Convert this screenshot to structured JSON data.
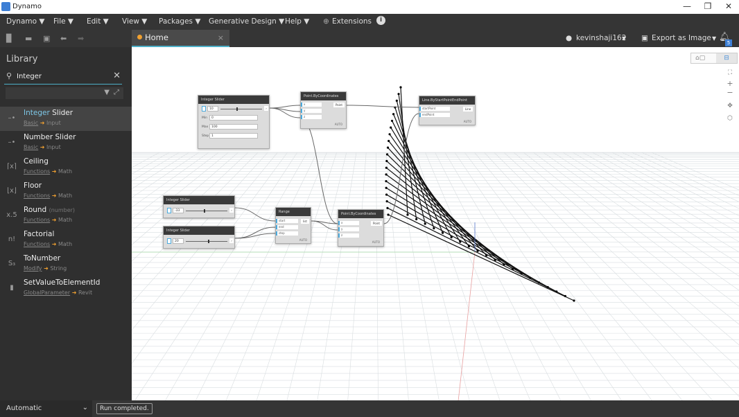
{
  "window": {
    "title": "Dynamo",
    "minimize": "—",
    "restore": "❐",
    "close": "✕"
  },
  "menu": [
    "Dynamo ▼",
    "File ▼",
    "Edit ▼",
    "View ▼",
    "Packages ▼",
    "Generative Design ▼",
    "Help ▼",
    "Extensions"
  ],
  "toolbar": {
    "icons": [
      "new-file-icon",
      "open-folder-icon",
      "save-icon",
      "undo-icon",
      "redo-icon"
    ]
  },
  "tab": {
    "label": "Home",
    "close": "×"
  },
  "topright": {
    "user": "kevinshaji162",
    "user_caret": "▼",
    "export": "Export as Image",
    "export_caret": "▼",
    "notification_count": "5"
  },
  "library": {
    "title": "Library",
    "search_value": "Integer",
    "items": [
      {
        "name_hl": "Integer",
        "name": " Slider",
        "sub": "",
        "cat": "Basic",
        "group": "Input",
        "icon": "slider-icon",
        "glyph": "–•"
      },
      {
        "name_hl": "",
        "name": "Number Slider",
        "sub": "",
        "cat": "Basic",
        "group": "Input",
        "icon": "slider-icon",
        "glyph": "–•"
      },
      {
        "name_hl": "",
        "name": "Ceiling",
        "sub": "",
        "cat": "Functions",
        "group": "Math",
        "icon": "ceiling-icon",
        "glyph": "⌈x⌉"
      },
      {
        "name_hl": "",
        "name": "Floor",
        "sub": "",
        "cat": "Functions",
        "group": "Math",
        "icon": "floor-icon",
        "glyph": "⌊x⌋"
      },
      {
        "name_hl": "",
        "name": "Round",
        "sub": "(number)",
        "cat": "Functions",
        "group": "Math",
        "icon": "round-icon",
        "glyph": "x.5"
      },
      {
        "name_hl": "",
        "name": "Factorial",
        "sub": "",
        "cat": "Functions",
        "group": "Math",
        "icon": "factorial-icon",
        "glyph": "n!"
      },
      {
        "name_hl": "",
        "name": "ToNumber",
        "sub": "",
        "cat": "Modify",
        "group": "String",
        "icon": "tonumber-icon",
        "glyph": "S₃"
      },
      {
        "name_hl": "",
        "name": "SetValueToElementId",
        "sub": "",
        "cat": "GlobalParameter",
        "group": "Revit",
        "icon": "revit-icon",
        "glyph": "▮"
      }
    ]
  },
  "nodes": {
    "slider1": {
      "title": "Integer Slider",
      "value": "10",
      "min_label": "Min",
      "min": "0",
      "max_label": "Max",
      "max": "100",
      "step_label": "Step",
      "step": "1",
      "level": 0.4
    },
    "slider2": {
      "title": "Integer Slider",
      "value": "-33",
      "level": 0.45
    },
    "slider3": {
      "title": "Integer Slider",
      "value": "20",
      "level": 0.55
    },
    "pbc1": {
      "title": "Point.ByCoordinates",
      "inputs": [
        "x",
        "y",
        "z"
      ],
      "output": "Point",
      "lacing": "AUTO"
    },
    "line": {
      "title": "Line.ByStartPointEndPoint",
      "inputs": [
        "startPoint",
        "endPoint"
      ],
      "output": "Line",
      "lacing": "AUTO"
    },
    "range": {
      "title": "Range",
      "inputs": [
        "start",
        "end",
        "step"
      ],
      "output": "list",
      "lacing": "AUTO"
    },
    "pbc2": {
      "title": "Point.ByCoordinates",
      "inputs": [
        "x",
        "y",
        "z"
      ],
      "output": "Point",
      "lacing": "AUTO"
    }
  },
  "status": {
    "run_mode": "Automatic",
    "caret": "⌄",
    "message": "Run completed."
  },
  "colors": {
    "accent": "#4db0c8",
    "tab_dot": "#f0a030",
    "panel": "#2f2f2f",
    "bar": "#353535"
  }
}
